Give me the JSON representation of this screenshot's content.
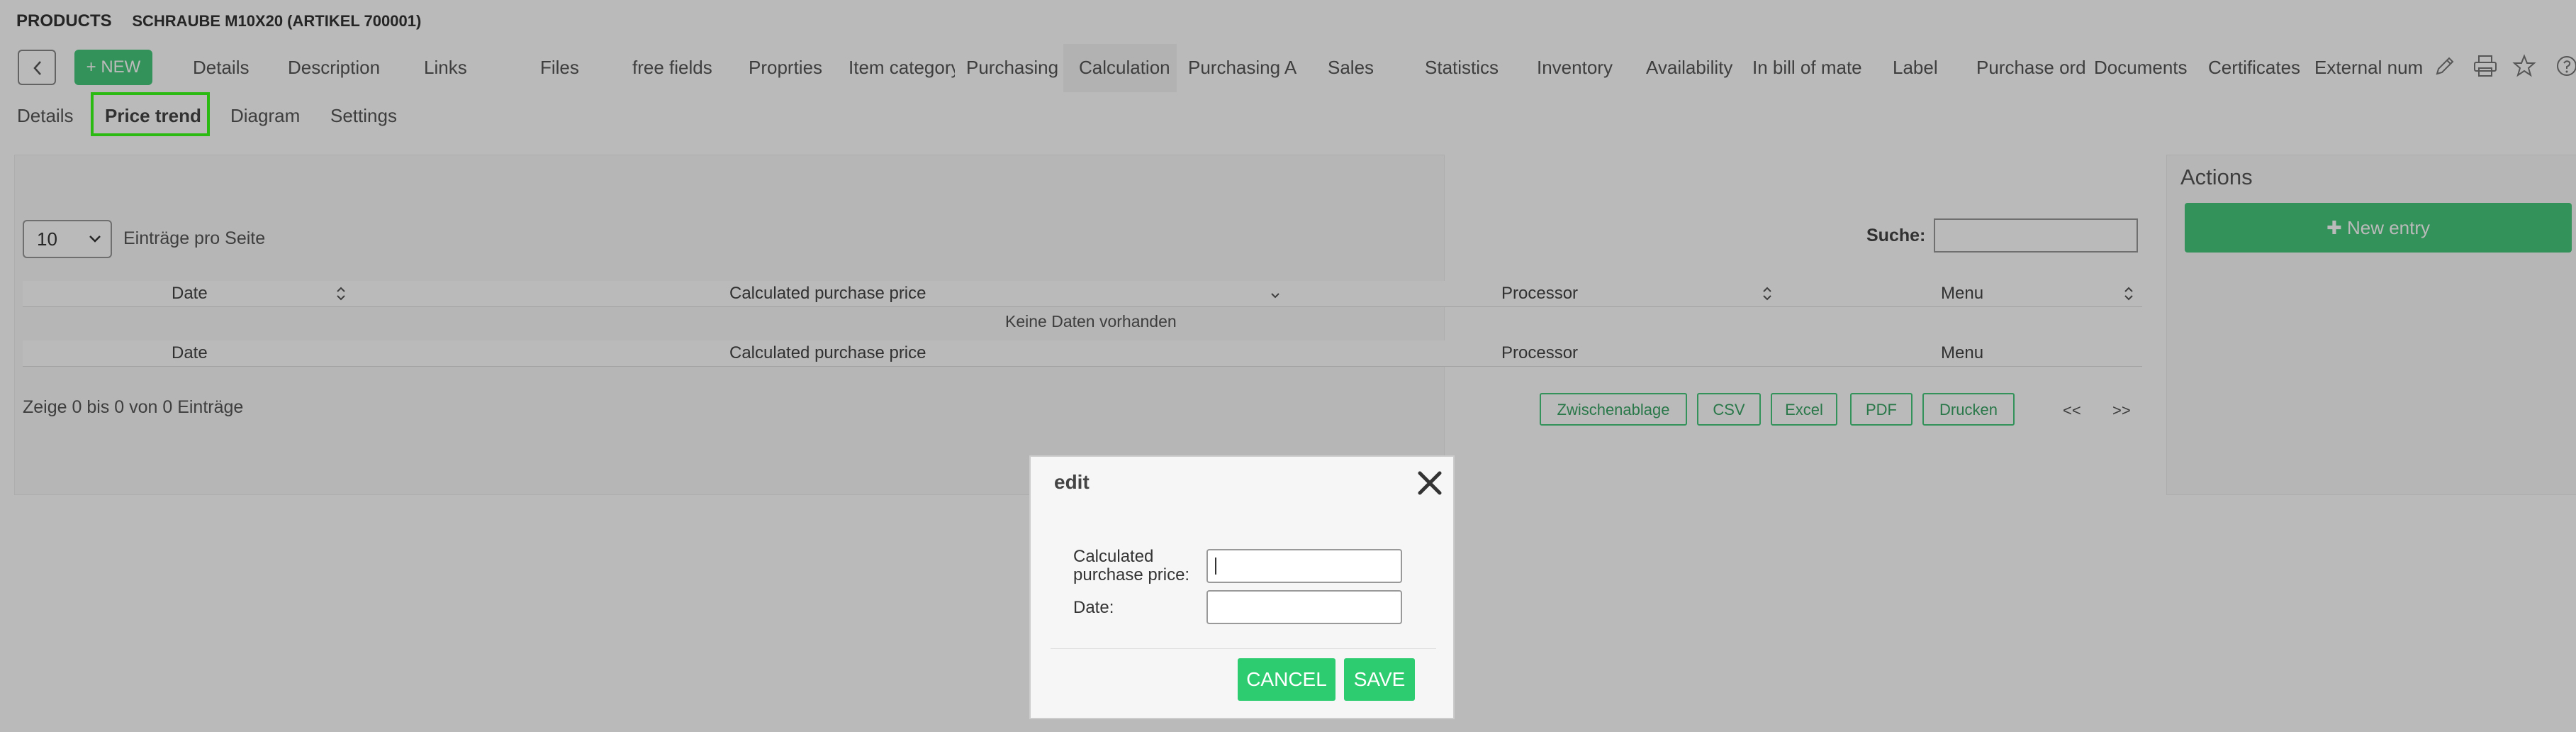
{
  "header": {
    "section": "PRODUCTS",
    "title": "SCHRAUBE M10X20 (ARTIKEL 700001)",
    "new_label": "+ NEW"
  },
  "tabs": [
    {
      "label": "Details"
    },
    {
      "label": "Description"
    },
    {
      "label": "Links"
    },
    {
      "label": "Files"
    },
    {
      "label": "free fields"
    },
    {
      "label": "Proprties"
    },
    {
      "label": "Item category"
    },
    {
      "label": "Purchasing"
    },
    {
      "label": "Calculation"
    },
    {
      "label": "Purchasing A"
    },
    {
      "label": "Sales"
    },
    {
      "label": "Statistics"
    },
    {
      "label": "Inventory"
    },
    {
      "label": "Availability"
    },
    {
      "label": "In bill of mate"
    },
    {
      "label": "Label"
    },
    {
      "label": "Purchase ord"
    },
    {
      "label": "Documents"
    },
    {
      "label": "Certificates"
    },
    {
      "label": "External num"
    }
  ],
  "subtabs": [
    {
      "label": "Details"
    },
    {
      "label": "Price trend"
    },
    {
      "label": "Diagram"
    },
    {
      "label": "Settings"
    }
  ],
  "table": {
    "per_page_value": "10",
    "per_page_label": "Einträge pro Seite",
    "search_label": "Suche:",
    "columns": [
      "Date",
      "Calculated purchase price",
      "Processor",
      "Menu"
    ],
    "empty_text": "Keine Daten vorhanden",
    "info": "Zeige 0 bis 0 von 0 Einträge",
    "export_buttons": [
      "Zwischenablage",
      "CSV",
      "Excel",
      "PDF",
      "Drucken"
    ],
    "pager_prev": "<<",
    "pager_next": ">>"
  },
  "actions": {
    "title": "Actions",
    "new_entry_label": "New entry"
  },
  "modal": {
    "title": "edit",
    "price_label": "Calculated purchase price:",
    "date_label": "Date:",
    "price_value": "",
    "date_value": "",
    "cancel_label": "CANCEL",
    "save_label": "SAVE"
  },
  "colors": {
    "accent": "#45c97a",
    "modal_button": "#2ecc71",
    "highlight": "#3cff1a"
  }
}
